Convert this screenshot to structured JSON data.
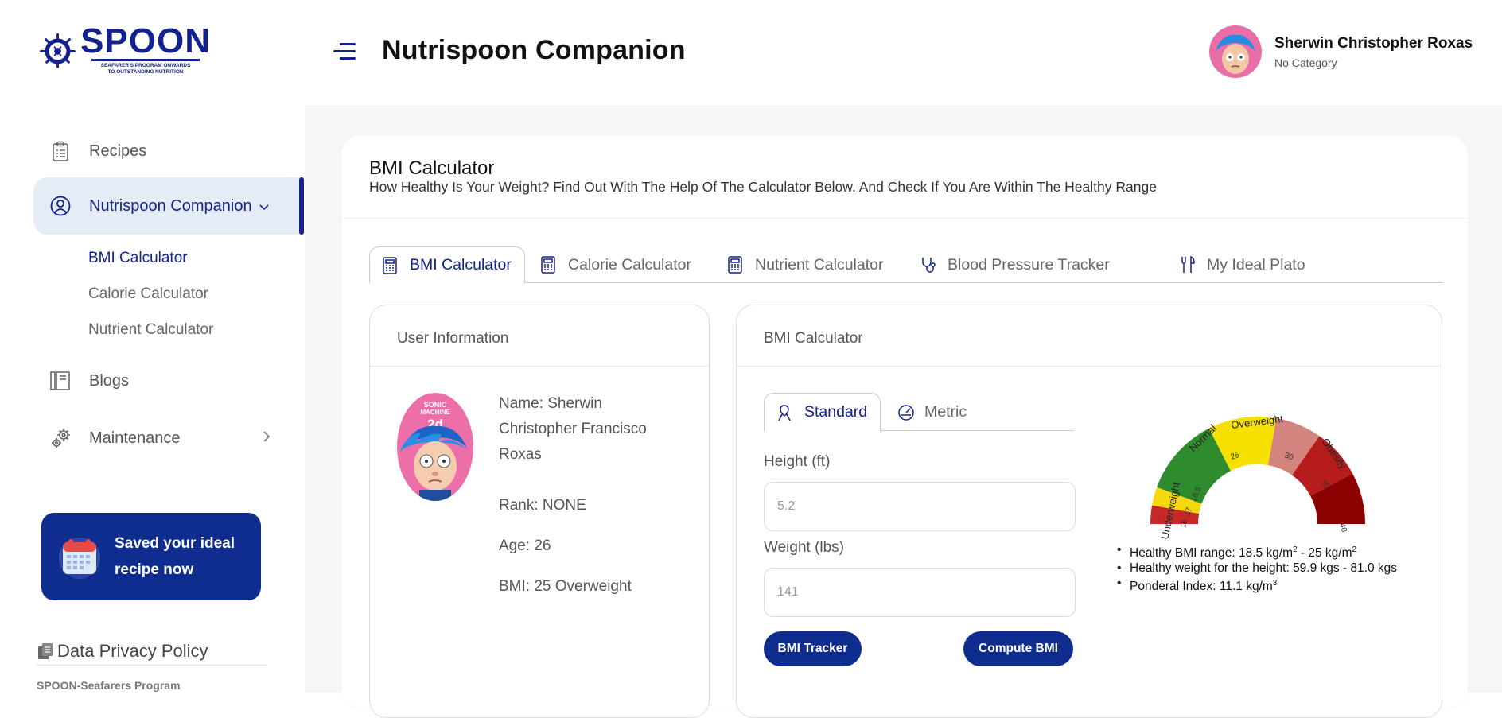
{
  "brand": {
    "logo_title": "SPOON",
    "logo_sub_1": "SEAFARER'S PROGRAM ONWARDS",
    "logo_sub_2": "TO OUTSTANDING NUTRITION"
  },
  "header": {
    "title": "Nutrispoon Companion",
    "user_name": "Sherwin Christopher Roxas",
    "user_category": "No Category"
  },
  "sidebar": {
    "items": [
      {
        "label": "Recipes",
        "icon": "clipboard-icon"
      },
      {
        "label": "Nutrispoon Companion",
        "icon": "user-circle-icon"
      },
      {
        "label": "Blogs",
        "icon": "book-icon"
      },
      {
        "label": "Maintenance",
        "icon": "gears-icon"
      }
    ],
    "sub_items": [
      "BMI Calculator",
      "Calorie Calculator",
      "Nutrient Calculator"
    ],
    "promo": {
      "line1": "Saved your ideal",
      "line2": "recipe now"
    },
    "privacy_label": "Data Privacy Policy",
    "footer_text": "SPOON-Seafarers Program"
  },
  "card": {
    "title": "BMI Calculator",
    "subtitle": "How Healthy Is Your Weight? Find Out With The Help Of The Calculator Below. And Check If You Are Within The Healthy Range",
    "tabs": [
      {
        "label": "BMI Calculator",
        "icon": "calculator-icon"
      },
      {
        "label": "Calorie Calculator",
        "icon": "calculator-icon"
      },
      {
        "label": "Nutrient Calculator",
        "icon": "calculator-icon"
      },
      {
        "label": "Blood Pressure Tracker",
        "icon": "stethoscope-icon"
      },
      {
        "label": "My Ideal Plato",
        "icon": "utensils-icon"
      }
    ]
  },
  "user_info": {
    "heading": "User Information",
    "name": "Name: Sherwin Christopher Francisco Roxas",
    "rank": "Rank: NONE",
    "age": "Age: 26",
    "bmi": "BMI: 25 Overweight"
  },
  "bmi_panel": {
    "heading": "BMI Calculator",
    "unit_tabs": [
      {
        "label": "Standard",
        "icon": "ribbon-icon"
      },
      {
        "label": "Metric",
        "icon": "gauge-icon"
      }
    ],
    "height_label": "Height (ft)",
    "height_value": "5.2",
    "weight_label": "Weight (lbs)",
    "weight_value": "141",
    "tracker_button": "BMI Tracker",
    "compute_button": "Compute BMI",
    "gauge": {
      "labels": [
        "Underweight",
        "Normal",
        "Overweight",
        "Obesity"
      ],
      "ticks": [
        "16",
        "17",
        "18.5",
        "25",
        "30",
        "35",
        "40"
      ],
      "colors": [
        "#c62828",
        "#f5d90a",
        "#2e8b2e",
        "#f5e000",
        "#d4847f",
        "#b71c1c",
        "#8b0000"
      ]
    },
    "results": {
      "range_a": "Healthy BMI range: 18.5 kg/m",
      "range_b": " - 25 kg/m",
      "sup2": "2",
      "weight": "Healthy weight for the height: 59.9 kgs - 81.0 kgs",
      "ponderal": "Ponderal Index: 11.1 kg/m",
      "sup3": "3"
    }
  }
}
